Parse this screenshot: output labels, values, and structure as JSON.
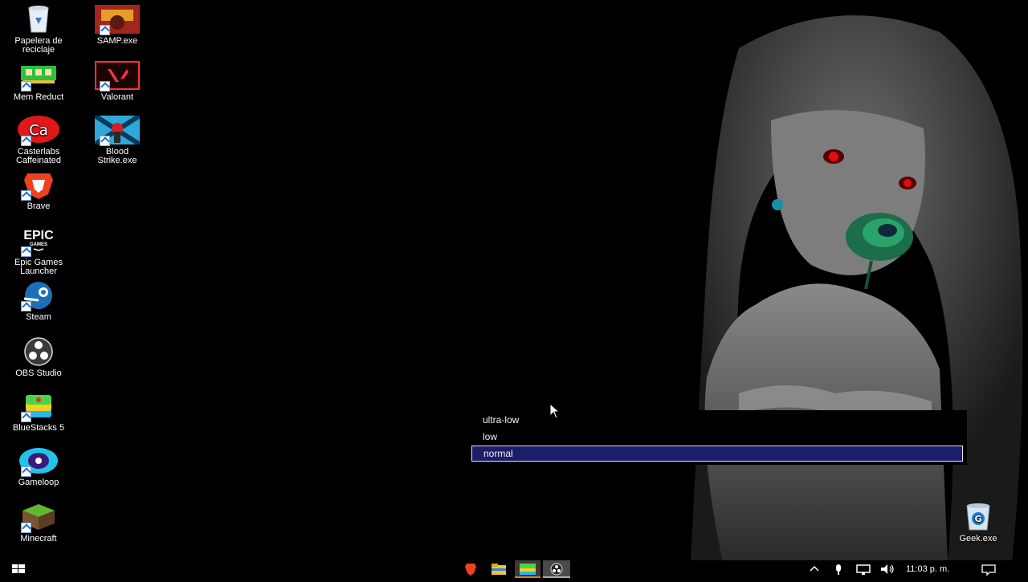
{
  "desktop": {
    "icons": [
      {
        "label_line1": "Papelera de",
        "label_line2": "reciclaje",
        "icon": "recycle-bin-icon"
      },
      {
        "label_line1": "SAMP.exe",
        "label_line2": "",
        "icon": "samp-icon"
      },
      {
        "label_line1": "Mem Reduct",
        "label_line2": "",
        "icon": "mem-reduct-icon"
      },
      {
        "label_line1": "Valorant",
        "label_line2": "",
        "icon": "valorant-icon"
      },
      {
        "label_line1": "Casterlabs",
        "label_line2": "Caffeinated",
        "icon": "casterlabs-icon"
      },
      {
        "label_line1": "Blood",
        "label_line2": "Strike.exe",
        "icon": "blood-strike-icon"
      },
      {
        "label_line1": "Brave",
        "label_line2": "",
        "icon": "brave-icon"
      },
      {
        "label_line1": "Epic Games",
        "label_line2": "Launcher",
        "icon": "epic-games-icon"
      },
      {
        "label_line1": "Steam",
        "label_line2": "",
        "icon": "steam-icon"
      },
      {
        "label_line1": "OBS Studio",
        "label_line2": "",
        "icon": "obs-icon"
      },
      {
        "label_line1": "BlueStacks 5",
        "label_line2": "",
        "icon": "bluestacks-icon"
      },
      {
        "label_line1": "Gameloop",
        "label_line2": "",
        "icon": "gameloop-icon"
      },
      {
        "label_line1": "Minecraft",
        "label_line2": "",
        "icon": "minecraft-icon"
      },
      {
        "label_line1": "Geek.exe",
        "label_line2": "",
        "icon": "geek-icon"
      }
    ],
    "epic_logo_text": "EPIC",
    "epic_logo_sub": "GAMES"
  },
  "dropdown": {
    "options": [
      "ultra-low",
      "low",
      "normal"
    ],
    "selected": "normal"
  },
  "taskbar": {
    "clock": "11:03 p. m.",
    "pinned": [
      "brave-icon",
      "file-explorer-icon",
      "bluestacks-icon",
      "obs-icon"
    ]
  },
  "colors": {
    "selection_bg": "#1b1f6a",
    "desktop_bg": "#000000"
  }
}
